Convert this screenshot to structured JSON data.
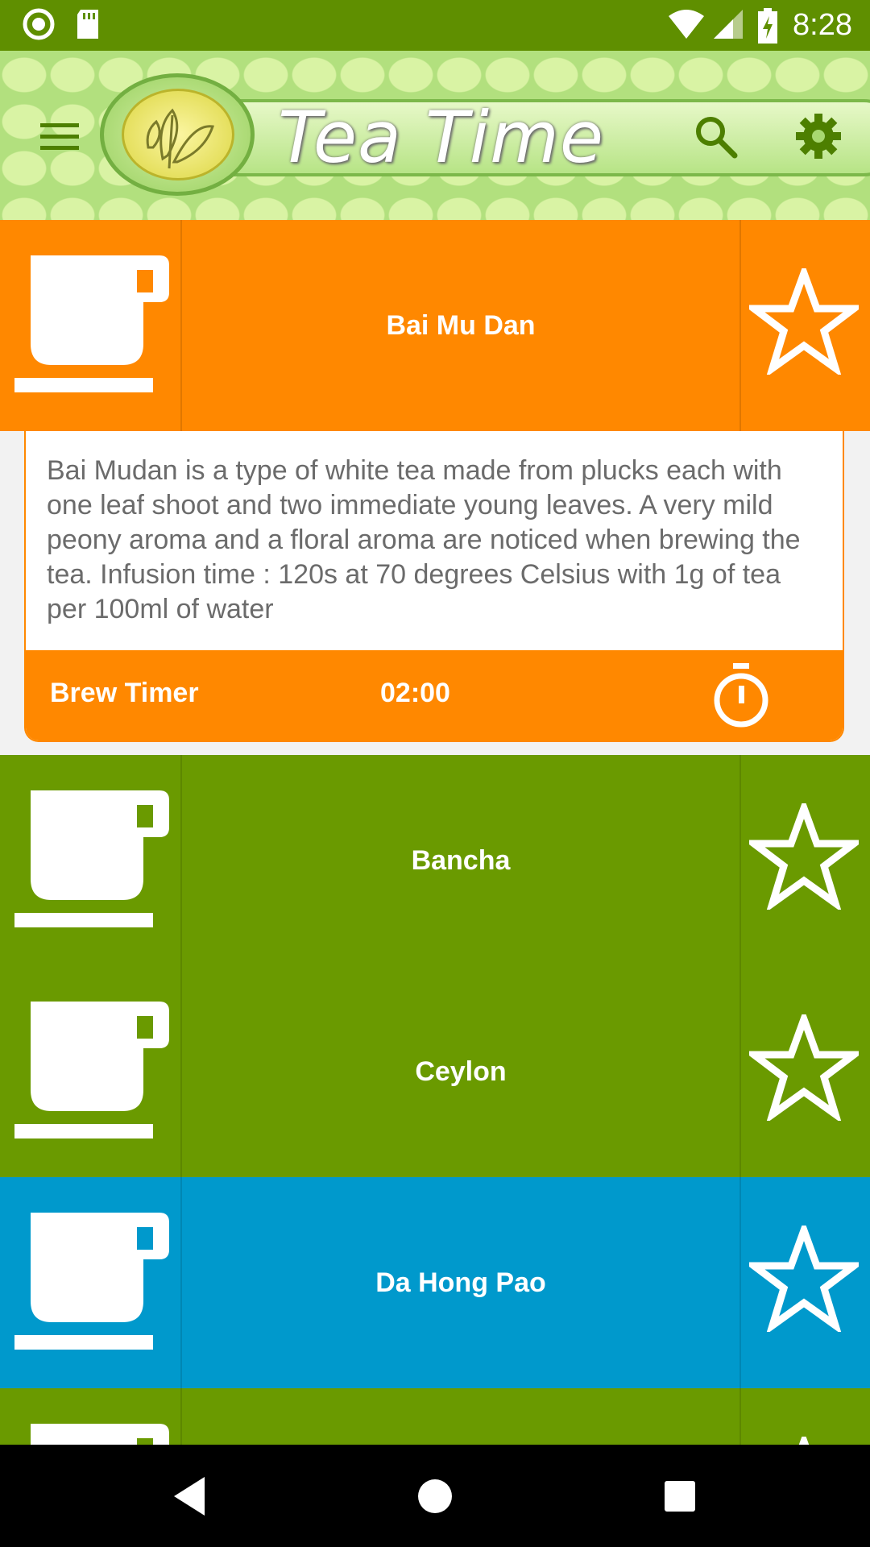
{
  "status_bar": {
    "time": "8:28"
  },
  "app_bar": {
    "title": "Tea Time",
    "menu_icon": "hamburger-menu-icon",
    "search_icon": "search-icon",
    "settings_icon": "gear-icon",
    "logo": "tea-leaf-logo"
  },
  "colors": {
    "status_bar": "#5f8f00",
    "white_tea": "#ff8800",
    "green_tea": "#6a9a00",
    "oolong_tea": "#0099cc",
    "nav_bar": "#000000"
  },
  "teas": [
    {
      "name": "Bai Mu Dan",
      "color": "#ff8800",
      "favorite": false,
      "expanded": true,
      "description": "Bai Mudan is a type of white tea made from plucks each with one leaf shoot and two immediate young leaves. A very mild peony aroma and a floral aroma are noticed when brewing the tea. Infusion time : 120s at 70 degrees Celsius with 1g of tea per 100ml of water",
      "brew_label": "Brew Timer",
      "brew_time": "02:00"
    },
    {
      "name": "Bancha",
      "color": "#6a9a00",
      "favorite": false
    },
    {
      "name": "Ceylon",
      "color": "#6a9a00",
      "favorite": false
    },
    {
      "name": "Da Hong Pao",
      "color": "#0099cc",
      "favorite": false
    },
    {
      "name": "",
      "color": "#6a9a00",
      "favorite": false
    }
  ],
  "nav": {
    "back_icon": "back-triangle-icon",
    "home_icon": "home-circle-icon",
    "recents_icon": "recents-square-icon"
  }
}
